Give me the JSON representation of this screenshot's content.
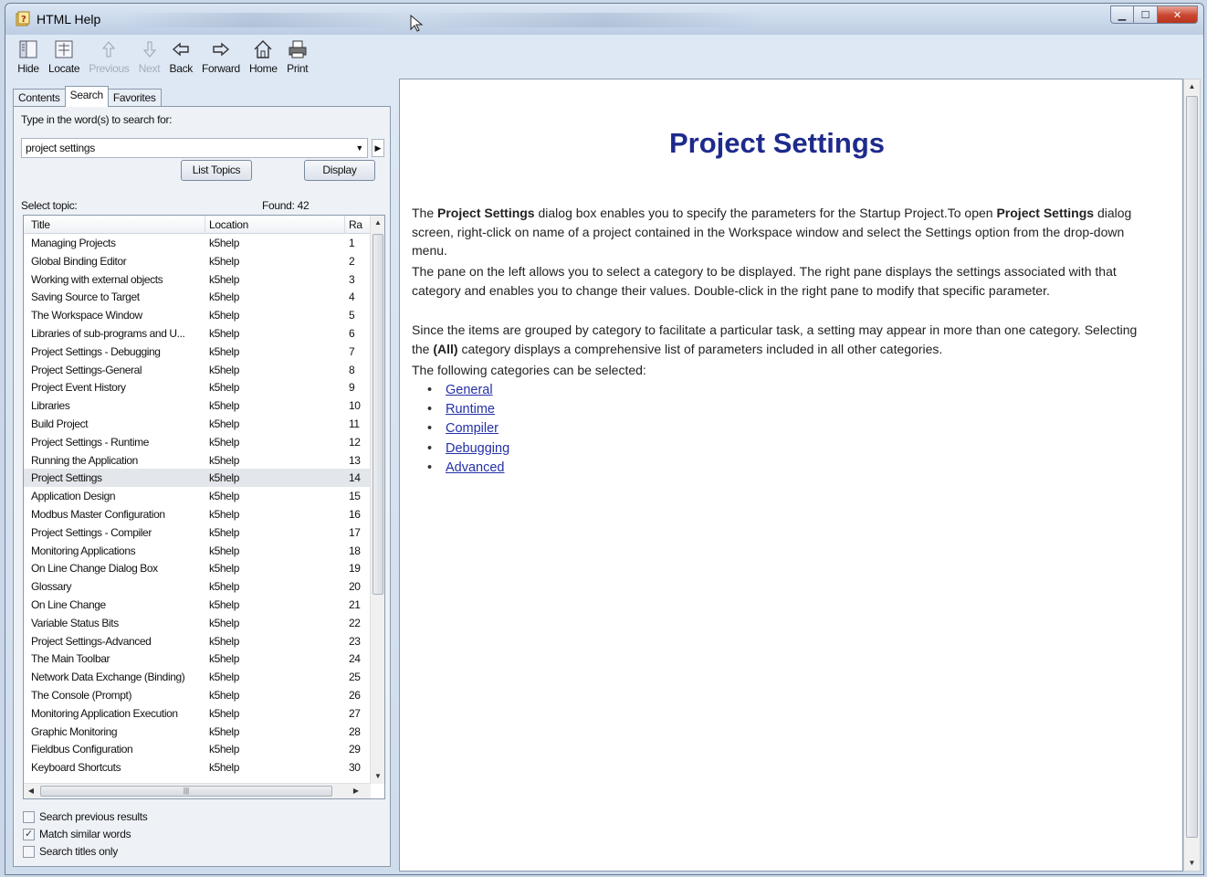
{
  "window": {
    "title": "HTML Help",
    "caption_buttons": [
      "minimize",
      "maximize",
      "close"
    ]
  },
  "toolbar": {
    "buttons": [
      {
        "label": "Hide",
        "icon": "hide-pane-icon",
        "enabled": true
      },
      {
        "label": "Locate",
        "icon": "locate-icon",
        "enabled": true
      },
      {
        "label": "Previous",
        "icon": "arrow-up-icon",
        "enabled": false
      },
      {
        "label": "Next",
        "icon": "arrow-down-icon",
        "enabled": false
      },
      {
        "label": "Back",
        "icon": "arrow-left-icon",
        "enabled": true
      },
      {
        "label": "Forward",
        "icon": "arrow-right-icon",
        "enabled": true
      },
      {
        "label": "Home",
        "icon": "home-icon",
        "enabled": true
      },
      {
        "label": "Print",
        "icon": "printer-icon",
        "enabled": true
      }
    ]
  },
  "nav": {
    "tabs": [
      {
        "label": "Contents",
        "active": false
      },
      {
        "label": "Search",
        "active": true
      },
      {
        "label": "Favorites",
        "active": false
      }
    ],
    "search_prompt": "Type in the word(s) to search for:",
    "search_value": "project settings",
    "list_topics_label": "List Topics",
    "display_label": "Display",
    "select_topic_label": "Select topic:",
    "found_label": "Found: 42",
    "columns": {
      "title": "Title",
      "location": "Location",
      "rank": "Ra"
    },
    "selected_row": 14,
    "results": [
      {
        "title": "Managing Projects",
        "location": "k5help",
        "rank": "1"
      },
      {
        "title": "Global Binding Editor",
        "location": "k5help",
        "rank": "2"
      },
      {
        "title": "Working with external objects",
        "location": "k5help",
        "rank": "3"
      },
      {
        "title": "Saving Source to Target",
        "location": "k5help",
        "rank": "4"
      },
      {
        "title": "The Workspace Window",
        "location": "k5help",
        "rank": "5"
      },
      {
        "title": "Libraries of sub-programs and U...",
        "location": "k5help",
        "rank": "6"
      },
      {
        "title": "Project Settings - Debugging",
        "location": "k5help",
        "rank": "7"
      },
      {
        "title": "Project Settings-General",
        "location": "k5help",
        "rank": "8"
      },
      {
        "title": "Project Event History",
        "location": "k5help",
        "rank": "9"
      },
      {
        "title": "Libraries",
        "location": "k5help",
        "rank": "10"
      },
      {
        "title": "Build Project",
        "location": "k5help",
        "rank": "11"
      },
      {
        "title": "Project Settings - Runtime",
        "location": "k5help",
        "rank": "12"
      },
      {
        "title": "Running the Application",
        "location": "k5help",
        "rank": "13"
      },
      {
        "title": "Project Settings",
        "location": "k5help",
        "rank": "14"
      },
      {
        "title": "Application Design",
        "location": "k5help",
        "rank": "15"
      },
      {
        "title": "Modbus Master Configuration",
        "location": "k5help",
        "rank": "16"
      },
      {
        "title": "Project Settings - Compiler",
        "location": "k5help",
        "rank": "17"
      },
      {
        "title": "Monitoring Applications",
        "location": "k5help",
        "rank": "18"
      },
      {
        "title": "On Line Change Dialog Box",
        "location": "k5help",
        "rank": "19"
      },
      {
        "title": "Glossary",
        "location": "k5help",
        "rank": "20"
      },
      {
        "title": "On Line Change",
        "location": "k5help",
        "rank": "21"
      },
      {
        "title": "Variable Status Bits",
        "location": "k5help",
        "rank": "22"
      },
      {
        "title": "Project Settings-Advanced",
        "location": "k5help",
        "rank": "23"
      },
      {
        "title": "The Main Toolbar",
        "location": "k5help",
        "rank": "24"
      },
      {
        "title": "Network Data Exchange (Binding)",
        "location": "k5help",
        "rank": "25"
      },
      {
        "title": "The Console (Prompt)",
        "location": "k5help",
        "rank": "26"
      },
      {
        "title": "Monitoring Application Execution",
        "location": "k5help",
        "rank": "27"
      },
      {
        "title": "Graphic Monitoring",
        "location": "k5help",
        "rank": "28"
      },
      {
        "title": "Fieldbus Configuration",
        "location": "k5help",
        "rank": "29"
      },
      {
        "title": "Keyboard Shortcuts",
        "location": "k5help",
        "rank": "30"
      }
    ],
    "options": [
      {
        "label": "Search previous results",
        "checked": false
      },
      {
        "label": "Match similar words",
        "checked": true
      },
      {
        "label": "Search titles only",
        "checked": false
      }
    ]
  },
  "content": {
    "heading": "Project Settings",
    "heading_color": "#1e2a8c",
    "link_color": "#2430a8",
    "p1": {
      "a": "The ",
      "b1": "Project Settings",
      "c": " dialog box enables you to specify the parameters for the Startup Project.To open ",
      "b2": "Project Settings",
      "d": " dialog screen, right-click on name of a project contained in the Workspace window and select the Settings option from the drop-down menu."
    },
    "p2": "The pane on the left allows you to select a category to be displayed. The right pane displays the settings associated with that category and enables you to change their values. Double-click in the right pane to modify that specific parameter.",
    "p3": {
      "a": "Since the items are grouped by category to facilitate a particular task, a setting may appear in more than one category. Selecting the ",
      "b": "(All)",
      "c": " category displays a comprehensive list of parameters included in all other categories."
    },
    "p4": "The following categories can be selected:",
    "categories": [
      "General",
      "Runtime",
      "Compiler",
      "Debugging",
      "Advanced"
    ]
  }
}
